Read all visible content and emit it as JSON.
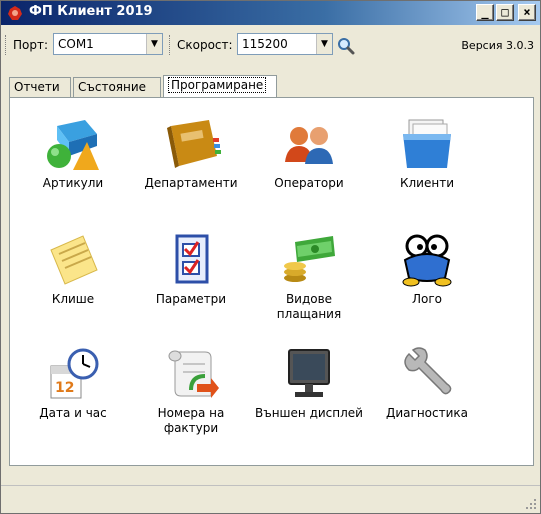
{
  "window": {
    "title": "ФП Клиент 2019",
    "minimize": "_",
    "maximize": "□",
    "close": "×"
  },
  "toolbar": {
    "port_label": "Порт:",
    "port_value": "COM1",
    "speed_label": "Скорост:",
    "speed_value": "115200",
    "version": "Версия 3.0.3"
  },
  "tabs": [
    {
      "label": "Отчети"
    },
    {
      "label": "Състояние"
    },
    {
      "label": "Програмиране"
    }
  ],
  "items": [
    {
      "label": "Артикули",
      "icon": "shapes-icon"
    },
    {
      "label": "Департаменти",
      "icon": "book-icon"
    },
    {
      "label": "Оператори",
      "icon": "users-icon"
    },
    {
      "label": "Клиенти",
      "icon": "folder-icon"
    },
    {
      "label": "Клише",
      "icon": "notepad-icon"
    },
    {
      "label": "Параметри",
      "icon": "checklist-icon"
    },
    {
      "label": "Видове\nплащания",
      "icon": "money-icon"
    },
    {
      "label": "Лого",
      "icon": "logo-icon"
    },
    {
      "label": "Дата и час",
      "icon": "calendar-clock-icon"
    },
    {
      "label": "Номера на\nфактури",
      "icon": "scroll-icon"
    },
    {
      "label": "Външен дисплей",
      "icon": "monitor-icon"
    },
    {
      "label": "Диагностика",
      "icon": "wrench-icon"
    }
  ],
  "colors": {
    "titlebar": "#0a246a",
    "window": "#ece9d8",
    "panel": "#ffffff"
  }
}
